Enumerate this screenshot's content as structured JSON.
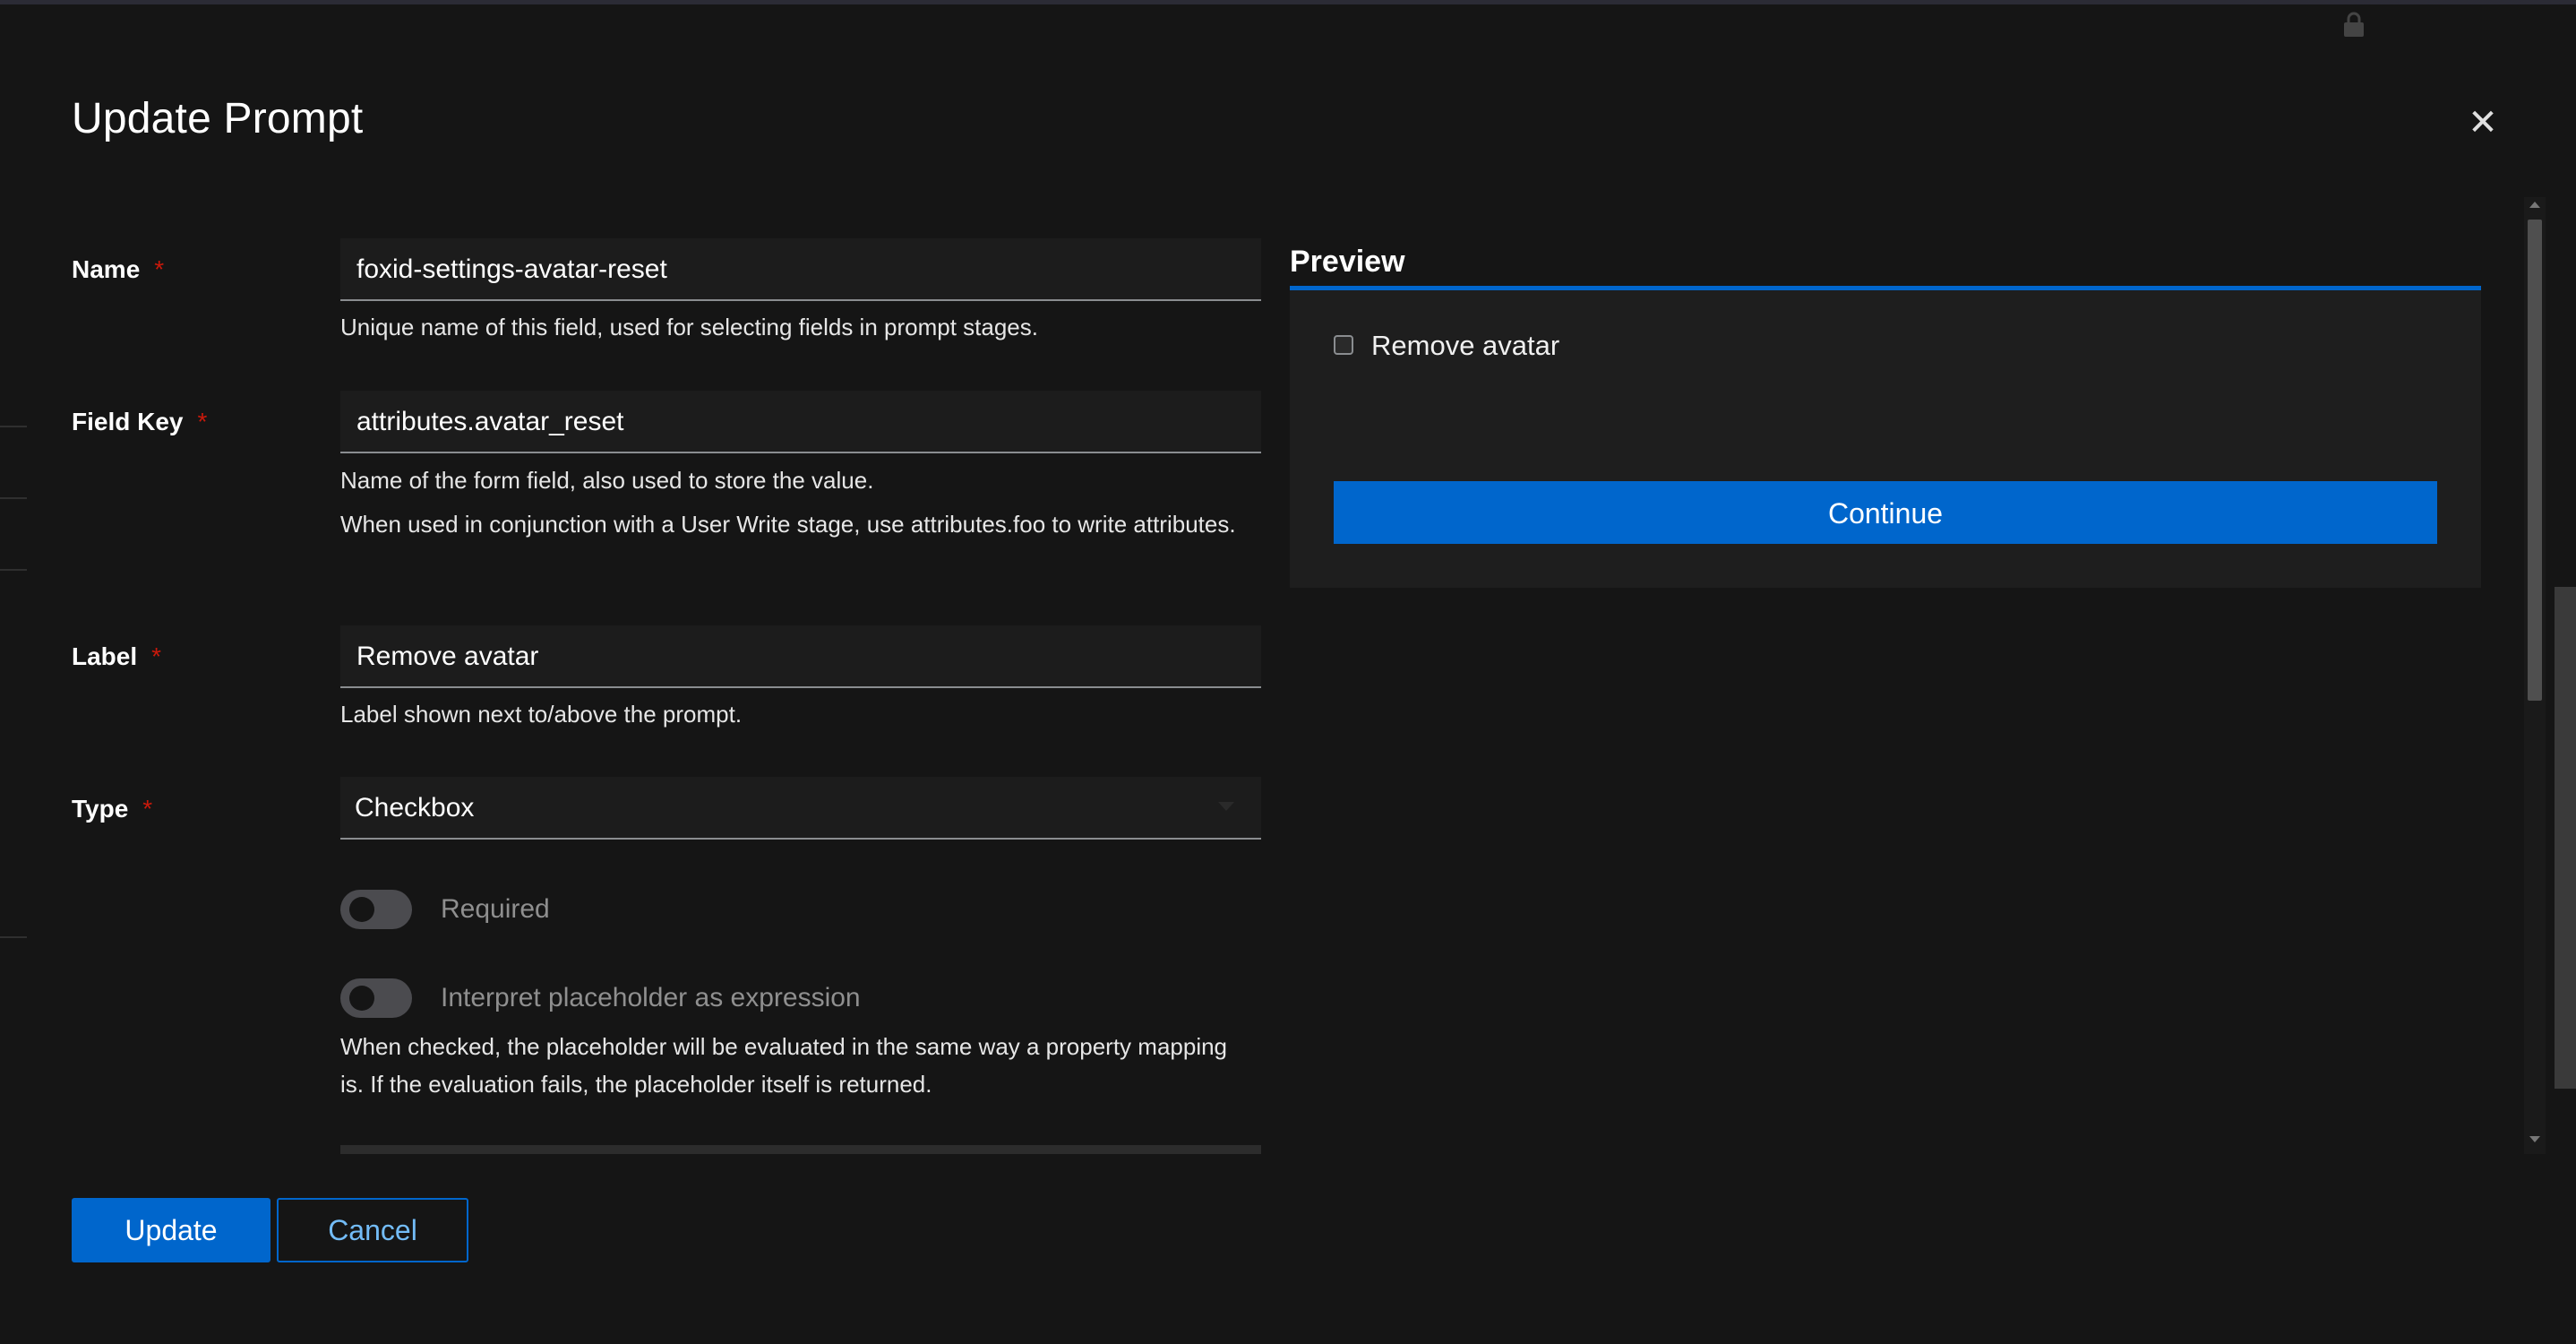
{
  "modal": {
    "title": "Update Prompt",
    "close_icon": "close-icon",
    "lock_icon": "lock-icon"
  },
  "form": {
    "name": {
      "label": "Name",
      "required_mark": "*",
      "value": "foxid-settings-avatar-reset",
      "help": "Unique name of this field, used for selecting fields in prompt stages."
    },
    "field_key": {
      "label": "Field Key",
      "required_mark": "*",
      "value": "attributes.avatar_reset",
      "help1": "Name of the form field, also used to store the value.",
      "help2": "When used in conjunction with a User Write stage, use attributes.foo to write attributes."
    },
    "label_field": {
      "label": "Label",
      "required_mark": "*",
      "value": "Remove avatar",
      "help": "Label shown next to/above the prompt."
    },
    "type": {
      "label": "Type",
      "required_mark": "*",
      "value": "Checkbox"
    },
    "required_switch": {
      "label": "Required",
      "on": false
    },
    "placeholder_expression_switch": {
      "label": "Interpret placeholder as expression",
      "on": false,
      "help": "When checked, the placeholder will be evaluated in the same way a property mapping is. If the evaluation fails, the placeholder itself is returned."
    }
  },
  "preview": {
    "title": "Preview",
    "checkbox_label": "Remove avatar",
    "checked": false,
    "continue_label": "Continue"
  },
  "footer": {
    "update_label": "Update",
    "cancel_label": "Cancel"
  },
  "colors": {
    "accent": "#0066cc",
    "required": "#c9190b",
    "background": "#151515"
  }
}
